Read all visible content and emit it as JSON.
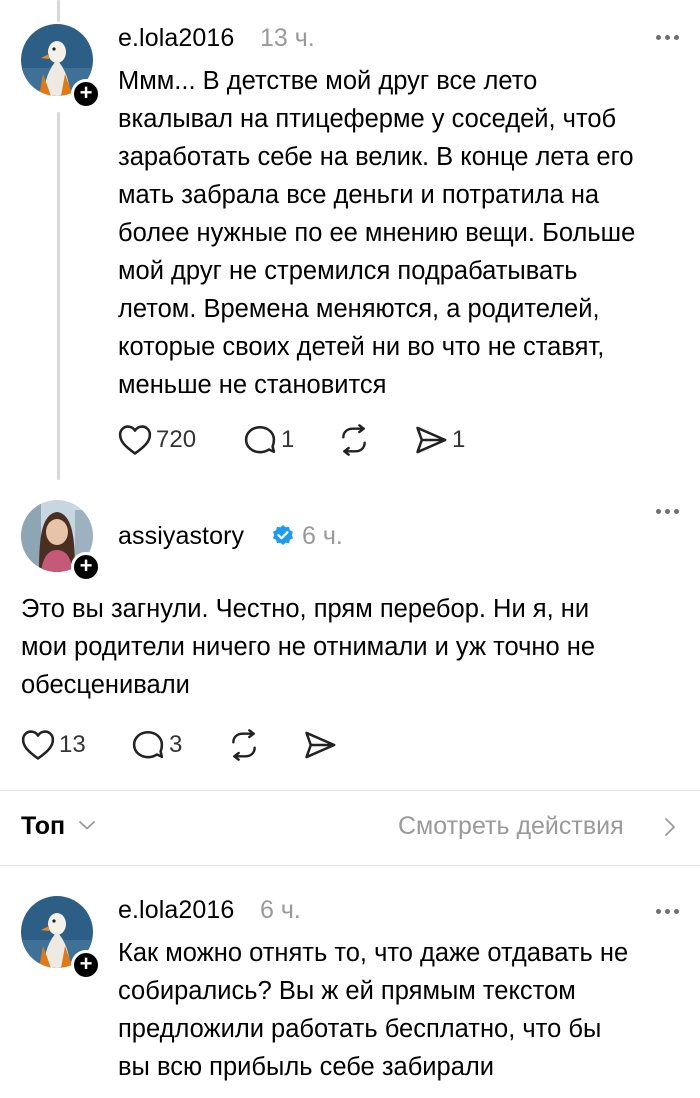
{
  "posts": [
    {
      "username": "e.lola2016",
      "time": "13 ч.",
      "text_lines": [
        "Ммм... В детстве мой друг все лето",
        "вкалывал на птицеферме у соседей, чтоб",
        "заработать себе на велик. В конце лета его",
        "мать забрала все деньги и потратила на",
        "более нужные по ее мнению вещи. Больше",
        "мой друг не стремился подрабатывать",
        "летом. Времена меняются, а родителей,",
        "которые своих детей ни во что не ставят,",
        "меньше не становится"
      ],
      "likes": "720",
      "replies": "1",
      "shares": "1"
    },
    {
      "username": "assiyastory",
      "verified": true,
      "time": "6 ч.",
      "text_lines": [
        "Это вы загнули. Честно, прям перебор. Ни я, ни",
        "мои родители ничего не отнимали и уж точно не",
        "обесценивали"
      ],
      "likes": "13",
      "replies": "3"
    },
    {
      "username": "e.lola2016",
      "time": "6 ч.",
      "text_lines": [
        "Как можно отнять то, что даже отдавать не",
        "собирались? Вы ж ей прямым текстом",
        "предложили работать бесплатно, что бы",
        "вы всю прибыль себе забирали"
      ]
    }
  ],
  "sort": {
    "label": "Топ",
    "see_activity": "Смотреть действия"
  },
  "colors": {
    "verified": "#1d9bf0",
    "muted": "#999999",
    "divider": "#e6e6e6"
  }
}
